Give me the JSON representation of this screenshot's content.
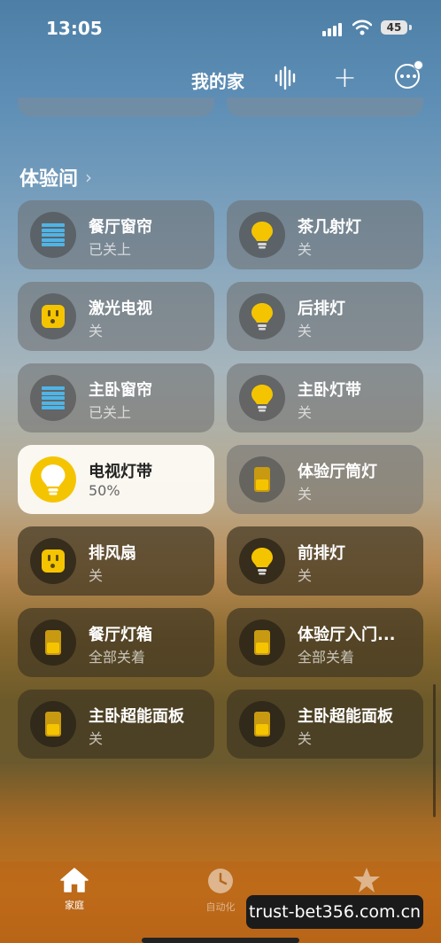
{
  "status_bar": {
    "time": "13:05",
    "battery": "45"
  },
  "nav": {
    "title": "我的家"
  },
  "section": {
    "title": "体验间"
  },
  "tiles": [
    {
      "name": "餐厅窗帘",
      "status": "已关上",
      "icon": "blinds-icon"
    },
    {
      "name": "茶几射灯",
      "status": "关",
      "icon": "bulb-icon"
    },
    {
      "name": "激光电视",
      "status": "关",
      "icon": "outlet-icon"
    },
    {
      "name": "后排灯",
      "status": "关",
      "icon": "bulb-icon"
    },
    {
      "name": "主卧窗帘",
      "status": "已关上",
      "icon": "blinds-icon"
    },
    {
      "name": "主卧灯带",
      "status": "关",
      "icon": "bulb-icon"
    },
    {
      "name": "电视灯带",
      "status": "50%",
      "icon": "bulb-icon",
      "on": true
    },
    {
      "name": "体验厅筒灯",
      "status": "关",
      "icon": "switch-icon"
    },
    {
      "name": "排风扇",
      "status": "关",
      "icon": "outlet-icon"
    },
    {
      "name": "前排灯",
      "status": "关",
      "icon": "bulb-icon"
    },
    {
      "name": "餐厅灯箱",
      "status": "全部关着",
      "icon": "switch-icon"
    },
    {
      "name": "体验厅入门...",
      "status": "全部关着",
      "icon": "switch-icon"
    },
    {
      "name": "主卧超能面板",
      "status": "关",
      "icon": "switch-icon"
    },
    {
      "name": "主卧超能面板",
      "status": "关",
      "icon": "switch-icon"
    }
  ],
  "tabs": [
    {
      "label": "家庭",
      "icon": "home-icon",
      "active": true
    },
    {
      "label": "自动化",
      "icon": "clock-icon",
      "active": false
    },
    {
      "label": "",
      "icon": "star-icon",
      "active": false
    }
  ],
  "watermark": "trust-bet356.com.cn",
  "colors": {
    "accent_yellow": "#f5c400",
    "blinds_blue": "#4fb4e6"
  }
}
